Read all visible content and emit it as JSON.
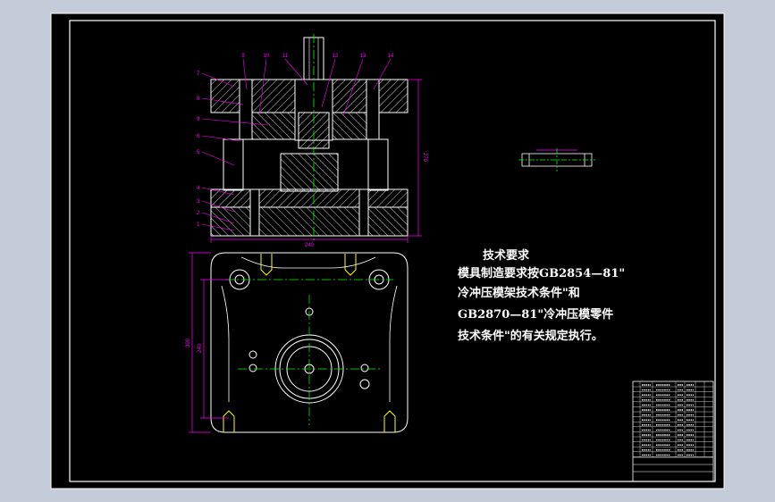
{
  "colors": {
    "background": "#c4cbd9",
    "sheet": "#000000",
    "border": "#ffffff",
    "part_outline": "#ffffff",
    "hatch": "#ffffff",
    "centerline": "#00ff00",
    "dimension": "#ff00ff",
    "leader": "#ff00ff",
    "bolt": "#ffff00",
    "title_block": "#ffffff"
  },
  "section_view": {
    "part_numbers_left": [
      "7",
      "8",
      "9",
      "6",
      "5",
      "4",
      "3",
      "2",
      "1"
    ],
    "part_numbers_top": [
      "9",
      "10",
      "11",
      "12",
      "13",
      "14"
    ],
    "dim_width": "240",
    "dim_height": "270"
  },
  "plan_view": {
    "dim_outer": "300",
    "dim_inner": "240"
  },
  "tech_requirements": {
    "title": "技术要求",
    "lines": [
      "模具制造要求按GB2854—81\"",
      "冷冲压模架技术条件\"和",
      "GB2870—81\"冷冲压模零件",
      "技术条件\"的有关规定执行。"
    ]
  }
}
